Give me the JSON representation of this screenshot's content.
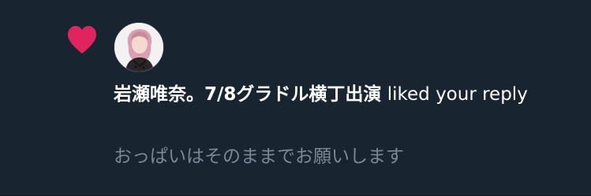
{
  "notification": {
    "actor_name": "岩瀬唯奈。7/8グラドル横丁出演",
    "action_text": "liked your reply",
    "reply_text": "おっぱいはそのままでお願いします",
    "icon": "heart-icon",
    "colors": {
      "background": "#192431",
      "heart": "#e0245e",
      "primary_text": "#ffffff",
      "secondary_text": "#7a8896"
    }
  }
}
